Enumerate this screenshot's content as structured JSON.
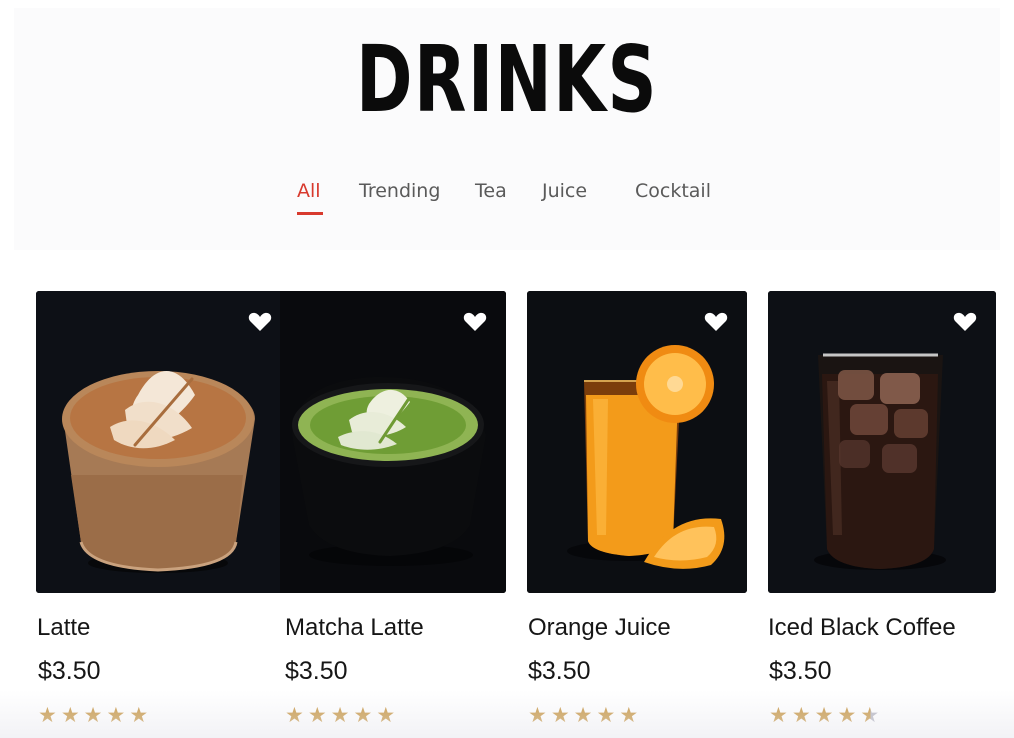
{
  "header": {
    "title": "DRINKS"
  },
  "tabs": [
    {
      "label": "All",
      "active": true
    },
    {
      "label": "Trending",
      "active": false
    },
    {
      "label": "Tea",
      "active": false
    },
    {
      "label": "Juice",
      "active": false
    },
    {
      "label": "Cocktail",
      "active": false
    }
  ],
  "products": [
    {
      "name": "Latte",
      "price": "$3.50",
      "rating": 5,
      "favorite_icon": "heart-icon"
    },
    {
      "name": "Matcha Latte",
      "price": "$3.50",
      "rating": 5,
      "favorite_icon": "heart-icon"
    },
    {
      "name": "Orange Juice",
      "price": "$3.50",
      "rating": 5,
      "favorite_icon": "heart-icon"
    },
    {
      "name": "Iced Black Coffee",
      "price": "$3.50",
      "rating": 4.5,
      "favorite_icon": "heart-icon"
    }
  ],
  "colors": {
    "accent": "#d83a2e",
    "star": "#c99a4a",
    "card_background": "#0b0d11"
  }
}
